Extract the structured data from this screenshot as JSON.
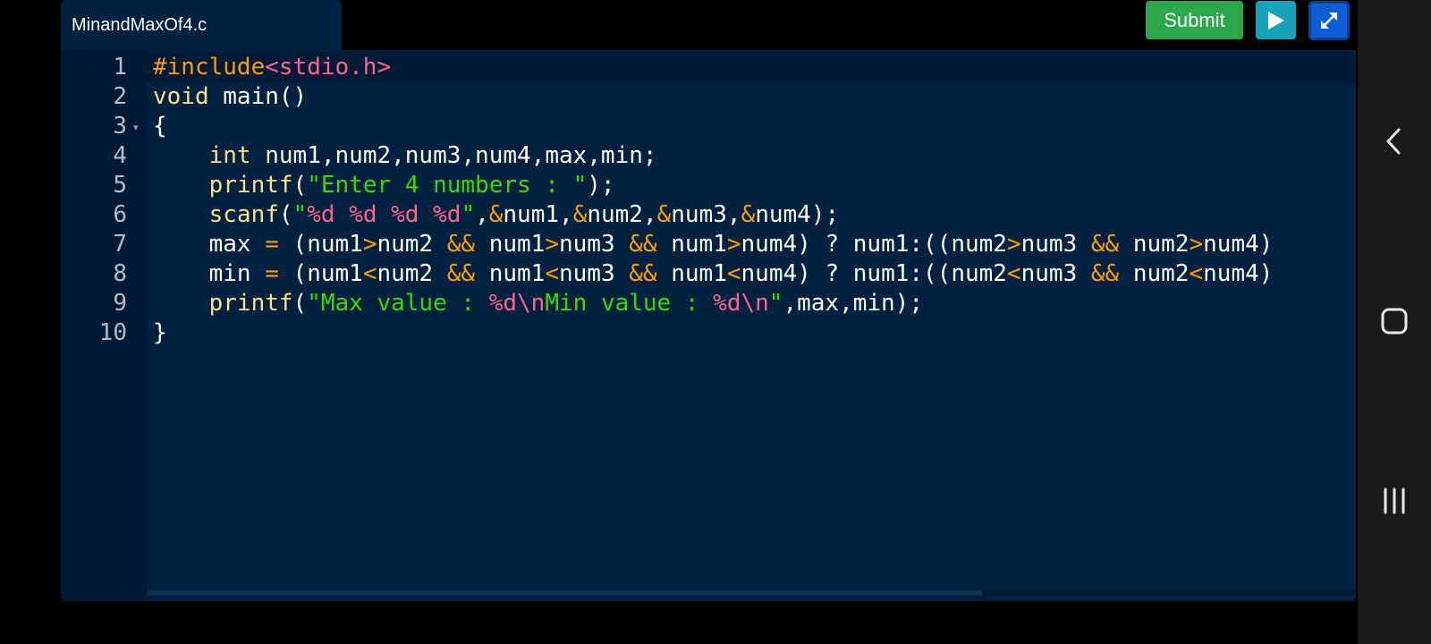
{
  "tab": {
    "filename": "MinandMaxOf4.c"
  },
  "toolbar": {
    "submit_label": "Submit",
    "run_icon": "play-icon",
    "expand_icon": "expand-icon"
  },
  "editor": {
    "line_numbers": [
      "1",
      "2",
      "3",
      "4",
      "5",
      "6",
      "7",
      "8",
      "9",
      "10"
    ],
    "lines": [
      "#include<stdio.h>",
      "void main()",
      "{",
      "    int num1,num2,num3,num4,max,min;",
      "    printf(\"Enter 4 numbers : \");",
      "    scanf(\"%d %d %d %d\",&num1,&num2,&num3,&num4);",
      "    max = (num1>num2 && num1>num3 && num1>num4) ? num1:((num2>num3 && num2>num4)",
      "    min = (num1<num2 && num1<num3 && num1<num4) ? num1:((num2<num3 && num2<num4)",
      "    printf(\"Max value : %d\\nMin value : %d\\n\",max,min);",
      "}"
    ]
  },
  "system_nav": {
    "back_icon": "back-chevron-icon",
    "home_icon": "home-icon",
    "recents_icon": "recents-icon"
  },
  "colors": {
    "editor_bg": "#00213f",
    "keyword": "#ffe086",
    "operator": "#ff9d00",
    "string": "#3ad900",
    "placeholder": "#ff628c",
    "submit_bg": "#2aa84a",
    "run_bg": "#17a2b8",
    "expand_bg": "#0d5fd8"
  }
}
